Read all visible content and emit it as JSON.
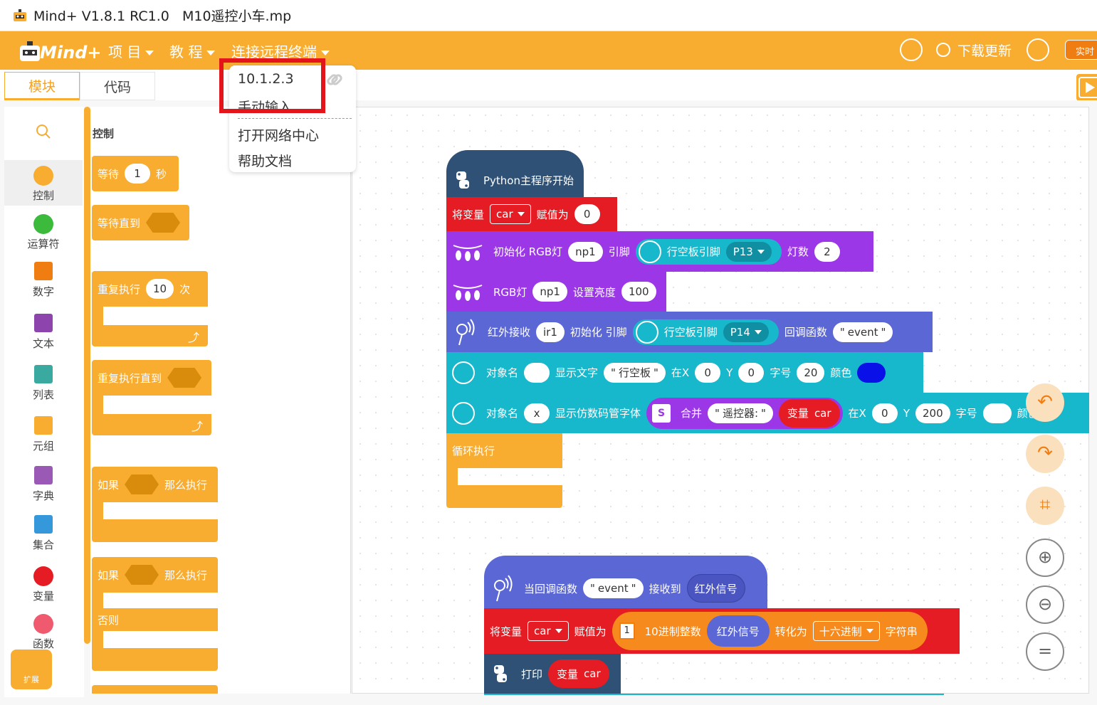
{
  "window": {
    "title": "Mind+ V1.8.1 RC1.0   M10遥控小车.mp"
  },
  "menubar": {
    "logo_text": "Mind+",
    "project": "项 目",
    "tutorial": "教 程",
    "connect": "连接远程终端",
    "download_update": "下载更新",
    "realtime": "实时"
  },
  "tabs": {
    "blocks": "模块",
    "code": "代码"
  },
  "dropdown": {
    "ip": "10.1.2.3",
    "manual": "手动输入",
    "network_center": "打开网络中心",
    "help": "帮助文档"
  },
  "categories": [
    {
      "label": "控制",
      "color": "#f8ac30",
      "icon": "control-dot-icon"
    },
    {
      "label": "运算符",
      "color": "#3cba3c",
      "icon": "operator-dot-icon"
    },
    {
      "label": "数字",
      "color": "#f07d12",
      "icon": "number-icon"
    },
    {
      "label": "文本",
      "color": "#8e44ad",
      "icon": "text-icon"
    },
    {
      "label": "列表",
      "color": "#3aa99f",
      "icon": "list-icon"
    },
    {
      "label": "元组",
      "color": "#f8ac30",
      "icon": "tuple-icon"
    },
    {
      "label": "字典",
      "color": "#9b59b6",
      "icon": "dict-icon"
    },
    {
      "label": "集合",
      "color": "#3498db",
      "icon": "set-icon"
    },
    {
      "label": "变量",
      "color": "#e51c23",
      "icon": "variable-dot-icon"
    },
    {
      "label": "函数",
      "color": "#f05a6e",
      "icon": "function-dot-icon"
    }
  ],
  "extension": {
    "label": "扩展"
  },
  "palette": {
    "title": "控制",
    "wait": {
      "label": "等待",
      "value": "1",
      "unit": "秒"
    },
    "wait_until": {
      "label": "等待直到"
    },
    "repeat": {
      "label": "重复执行",
      "value": "10",
      "unit": "次"
    },
    "repeat_until": {
      "label": "重复执行直到"
    },
    "if_then": {
      "label": "如果",
      "then": "那么执行"
    },
    "if_else": {
      "label": "如果",
      "then": "那么执行",
      "else": "否则"
    }
  },
  "script1": {
    "hat": "Python主程序开始",
    "set_var": {
      "label": "将变量",
      "var": "car",
      "assign": "赋值为",
      "value": "0"
    },
    "init_rgb": {
      "label": "初始化 RGB灯",
      "name": "np1",
      "pin_label": "引脚",
      "board_pin": "行空板引脚",
      "pin": "P13",
      "count_label": "灯数",
      "count": "2"
    },
    "rgb_brightness": {
      "label": "RGB灯",
      "name": "np1",
      "set_label": "设置亮度",
      "value": "100"
    },
    "ir_init": {
      "label": "红外接收",
      "name": "ir1",
      "init_label": "初始化 引脚",
      "board_pin": "行空板引脚",
      "pin": "P14",
      "callback_label": "回调函数",
      "callback": "event"
    },
    "show_text": {
      "obj_label": "对象名",
      "obj": "",
      "show_label": "显示文字",
      "text": "行空板",
      "x_label": "在X",
      "x": "0",
      "y_label": "Y",
      "y": "0",
      "size_label": "字号",
      "size": "20",
      "color_label": "颜色",
      "color": "#0a10e8"
    },
    "show_digit": {
      "obj_label": "对象名",
      "obj": "x",
      "show_label": "显示仿数码管字体",
      "join_label": "合并",
      "text": "遥控器:",
      "var_label": "变量",
      "var": "car",
      "x_label": "在X",
      "x": "0",
      "y_label": "Y",
      "y": "200",
      "size_label": "字号",
      "color_label": "颜色"
    },
    "forever": "循环执行"
  },
  "script2": {
    "hat": {
      "label": "当回调函数",
      "callback": "event",
      "recv_label": "接收到",
      "signal": "红外信号"
    },
    "set_var": {
      "label": "将变量",
      "var": "car",
      "assign": "赋值为",
      "conv_label": "10进制整数",
      "signal": "红外信号",
      "to_label": "转化为",
      "format": "十六进制",
      "str_label": "字符串"
    },
    "print": {
      "label": "打印",
      "var_label": "变量",
      "var": "car"
    }
  }
}
